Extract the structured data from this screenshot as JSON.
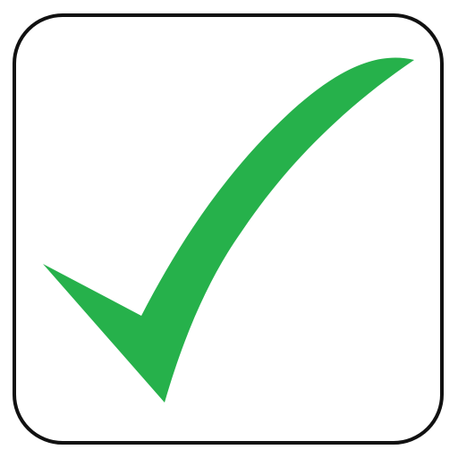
{
  "checkbox": {
    "checked": true,
    "icon": "checkmark-icon",
    "frame_color": "#111111",
    "background_color": "#ffffff",
    "check_color": "#26b14b"
  }
}
